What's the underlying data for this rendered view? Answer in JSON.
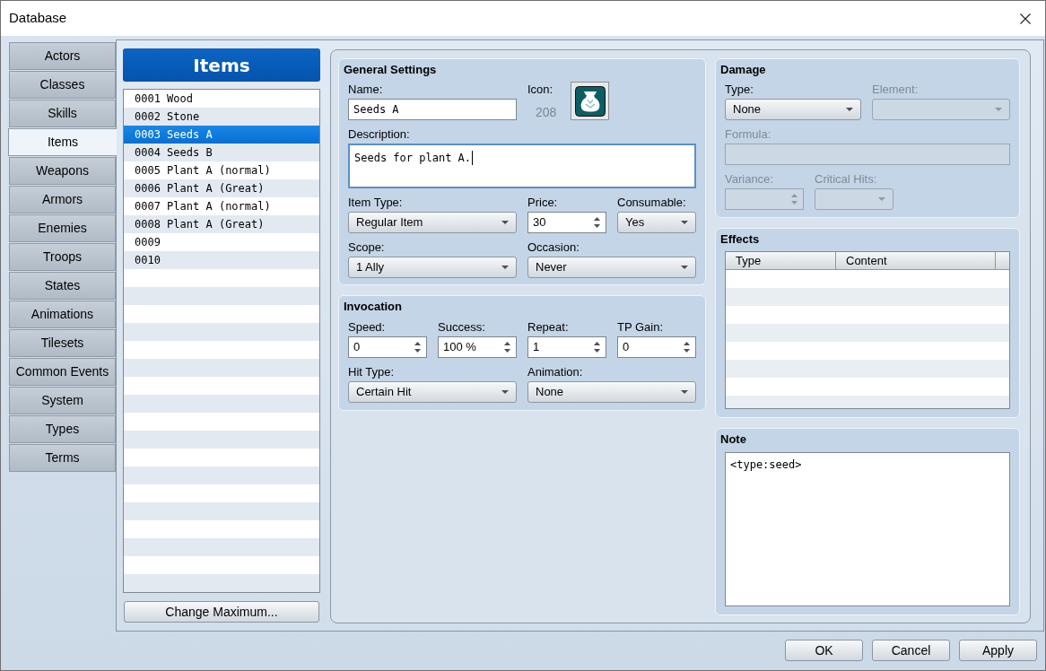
{
  "window": {
    "title": "Database"
  },
  "tabs": [
    {
      "label": "Actors",
      "selected": false
    },
    {
      "label": "Classes",
      "selected": false
    },
    {
      "label": "Skills",
      "selected": false
    },
    {
      "label": "Items",
      "selected": true
    },
    {
      "label": "Weapons",
      "selected": false
    },
    {
      "label": "Armors",
      "selected": false
    },
    {
      "label": "Enemies",
      "selected": false
    },
    {
      "label": "Troops",
      "selected": false
    },
    {
      "label": "States",
      "selected": false
    },
    {
      "label": "Animations",
      "selected": false
    },
    {
      "label": "Tilesets",
      "selected": false
    },
    {
      "label": "Common Events",
      "selected": false
    },
    {
      "label": "System",
      "selected": false
    },
    {
      "label": "Types",
      "selected": false
    },
    {
      "label": "Terms",
      "selected": false
    }
  ],
  "list": {
    "title": "Items",
    "rows": [
      {
        "label": "0001 Wood",
        "selected": false
      },
      {
        "label": "0002 Stone",
        "selected": false
      },
      {
        "label": "0003 Seeds A",
        "selected": true
      },
      {
        "label": "0004 Seeds B",
        "selected": false
      },
      {
        "label": "0005 Plant A (normal)",
        "selected": false
      },
      {
        "label": "0006 Plant A (Great)",
        "selected": false
      },
      {
        "label": "0007 Plant A (normal)",
        "selected": false
      },
      {
        "label": "0008 Plant A (Great)",
        "selected": false
      },
      {
        "label": "0009",
        "selected": false
      },
      {
        "label": "0010",
        "selected": false
      }
    ],
    "button": "Change Maximum..."
  },
  "general_settings": {
    "title": "General Settings",
    "name": {
      "kind": "text",
      "label": "Name:",
      "value": "Seeds A"
    },
    "icon": {
      "label": "Icon:",
      "number": "208"
    },
    "description": {
      "kind": "textarea",
      "label": "Description:",
      "value": "Seeds for plant A.",
      "focused": true
    },
    "item_type": {
      "kind": "select",
      "label": "Item Type:",
      "value": "Regular Item"
    },
    "price": {
      "kind": "spin",
      "label": "Price:",
      "value": "30"
    },
    "consumable": {
      "kind": "select",
      "label": "Consumable:",
      "value": "Yes"
    },
    "scope": {
      "kind": "select",
      "label": "Scope:",
      "value": "1 Ally"
    },
    "occasion": {
      "kind": "select",
      "label": "Occasion:",
      "value": "Never"
    }
  },
  "invocation": {
    "title": "Invocation",
    "speed": {
      "kind": "spin",
      "label": "Speed:",
      "value": "0"
    },
    "success": {
      "kind": "spin",
      "label": "Success:",
      "value": "100 %"
    },
    "repeat": {
      "kind": "spin",
      "label": "Repeat:",
      "value": "1"
    },
    "tp_gain": {
      "kind": "spin",
      "label": "TP Gain:",
      "value": "0"
    },
    "hit_type": {
      "kind": "select",
      "label": "Hit Type:",
      "value": "Certain Hit"
    },
    "animation": {
      "kind": "select",
      "label": "Animation:",
      "value": "None"
    }
  },
  "damage": {
    "title": "Damage",
    "type": {
      "kind": "select",
      "label": "Type:",
      "value": "None",
      "disabled": false
    },
    "element": {
      "kind": "select",
      "label": "Element:",
      "disabled": true
    },
    "formula": {
      "kind": "text",
      "label": "Formula:",
      "disabled": true
    },
    "variance": {
      "kind": "spin",
      "label": "Variance:",
      "disabled": true
    },
    "critical_hits": {
      "kind": "select",
      "label": "Critical Hits:",
      "disabled": true
    }
  },
  "effects": {
    "title": "Effects",
    "columns": [
      "Type",
      "Content"
    ]
  },
  "note": {
    "title": "Note",
    "value": "<type:seed>"
  },
  "buttons": [
    "OK",
    "Cancel",
    "Apply"
  ]
}
